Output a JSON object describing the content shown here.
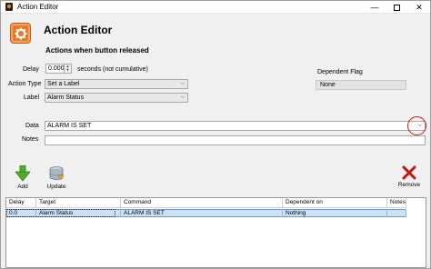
{
  "window": {
    "title": "Action Editor",
    "minimize": "—",
    "close": "✕"
  },
  "header": {
    "title": "Action Editor",
    "subtitle": "Actions when button released",
    "icon": "gear-icon",
    "accent": "#e97a2c"
  },
  "form": {
    "delay_label": "Delay",
    "delay_value": "0.000",
    "delay_unit": "seconds (not cumulative)",
    "action_type_label": "Action Type",
    "action_type_value": "Set a Label",
    "label_label": "Label",
    "label_value": "Alarm Status",
    "dependent_flag_label": "Dependent Flag",
    "dependent_flag_value": "None",
    "data_label": "Data",
    "data_value": "ALARM IS SET",
    "notes_label": "Notes",
    "notes_value": ""
  },
  "toolbar": {
    "add_label": "Add",
    "update_label": "Update",
    "remove_label": "Remove"
  },
  "grid": {
    "columns": [
      "Delay",
      "Target",
      "Command",
      "Dependent on",
      "Notes"
    ],
    "rows": [
      [
        "0.0",
        "Alarm Status",
        "ALARM IS SET",
        "Nothing",
        ""
      ]
    ]
  },
  "colors": {
    "highlight": "#d11111",
    "selection": "#cce0f8"
  }
}
